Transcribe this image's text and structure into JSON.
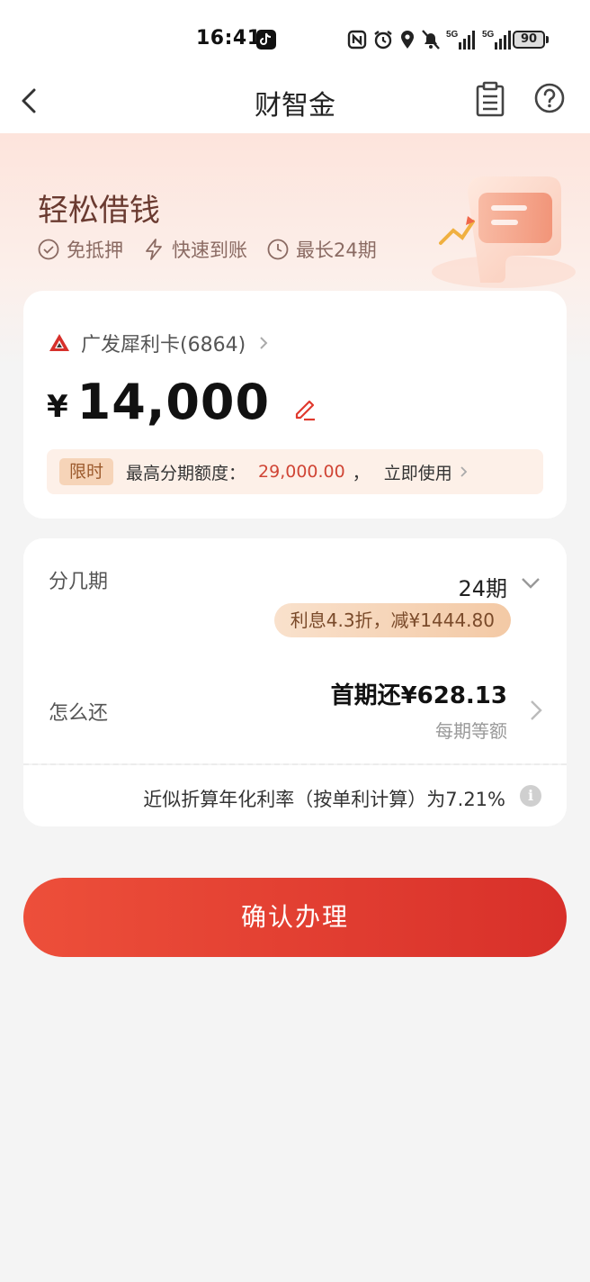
{
  "status_bar": {
    "time": "16:41",
    "battery": "90",
    "icons": [
      "tiktok-icon",
      "nfc-icon",
      "alarm-icon",
      "location-icon",
      "mute-icon",
      "signal-5g-icon",
      "signal-5g-icon"
    ]
  },
  "nav": {
    "title": "财智金",
    "icons": [
      "back-icon",
      "document-icon",
      "help-icon"
    ]
  },
  "hero": {
    "title": "轻松借钱",
    "features": [
      "免抵押",
      "快速到账",
      "最长24期"
    ]
  },
  "loan": {
    "bank": "广发犀利卡(6864)",
    "currency": "¥",
    "amount": "14,000",
    "promo": {
      "tag": "限时",
      "text": "最高分期额度：",
      "value": "29,000.00",
      "separator": "，",
      "link": "立即使用"
    }
  },
  "plan": {
    "label": "分几期",
    "value": "24期",
    "discount": "利息4.3折，减¥1444.80",
    "repay_label": "怎么还",
    "repay_value": "首期还¥628.13",
    "repay_sub": "每期等额"
  },
  "rate": {
    "text": "近似折算年化利率（按单利计算）为7.21%"
  },
  "confirm": {
    "label": "确认办理"
  },
  "colors": {
    "accent": "#e0392d",
    "promo_value": "#d04535",
    "hero_title": "#6a3a30"
  }
}
